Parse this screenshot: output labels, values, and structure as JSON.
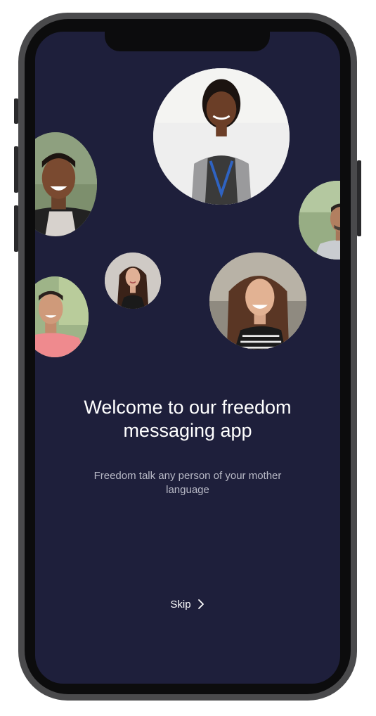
{
  "screen": {
    "title": "Welcome to our freedom messaging app",
    "subtitle": "Freedom talk any person of your mother language",
    "skip_label": "Skip",
    "skip_icon": "chevron-right-icon",
    "background": "#1e1f3b"
  },
  "avatars": [
    {
      "name": "woman-with-lanyard"
    },
    {
      "name": "smiling-man"
    },
    {
      "name": "older-man"
    },
    {
      "name": "long-haired-woman"
    },
    {
      "name": "man-pink-shirt"
    },
    {
      "name": "smiling-woman-striped-top"
    }
  ]
}
